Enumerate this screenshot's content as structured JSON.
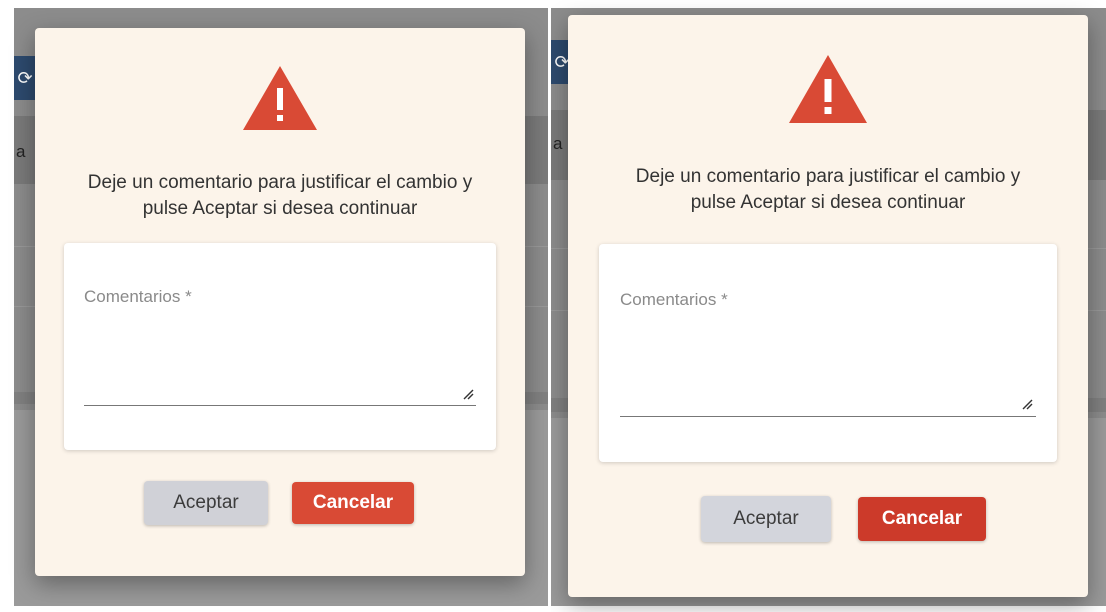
{
  "colors": {
    "dialog_bg": "#fcf4ea",
    "warning": "#d94a35",
    "accept_bg": "#d0d1d7",
    "cancel_bg": "#d94a35",
    "backdrop": "#8c8c8c",
    "toolbar": "#2d4a6e"
  },
  "background": {
    "toolbar_icon": "refresh-icon",
    "column_letter": "a"
  },
  "dialogs": [
    {
      "icon": "warning-icon",
      "message": "Deje un comentario para justificar el cambio y pulse Aceptar si desea continuar",
      "field": {
        "label": "Comentarios *",
        "value": ""
      },
      "accept_label": "Aceptar",
      "cancel_label": "Cancelar"
    },
    {
      "icon": "warning-icon",
      "message": "Deje un comentario para justificar el cambio y pulse Aceptar si desea continuar",
      "field": {
        "label": "Comentarios *",
        "value": ""
      },
      "accept_label": "Aceptar",
      "cancel_label": "Cancelar"
    }
  ]
}
